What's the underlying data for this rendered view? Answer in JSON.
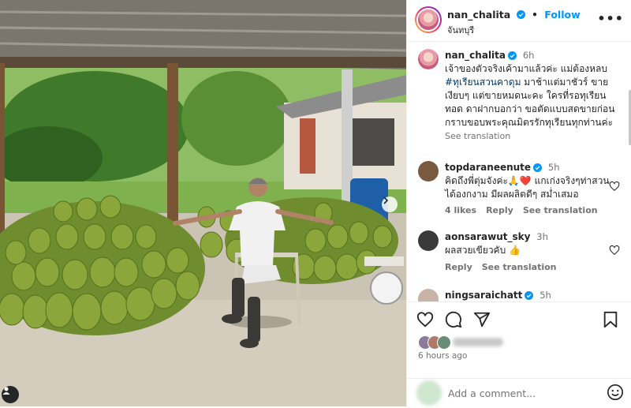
{
  "post": {
    "author": "nan_chalita",
    "location": "จันทบุรี",
    "follow_label": "Follow",
    "separator": "•",
    "more_label": "•••",
    "time_ago": "6 hours ago",
    "add_comment_placeholder": "Add a comment..."
  },
  "caption": {
    "username": "nan_chalita",
    "time": "6h",
    "text_before": "เจ้าของตัวจริงเค้ามาแล้วค่ะ แม่ต้องหลบ ",
    "hashtag": "#ทุเรียนสวนคาดุม",
    "text_after": " มาช้าแต่มาชัวร์ ขายเงียบๆ แต่ขายหมดนะคะ ใครที่รอทุเรียนทอด ดาฝากบอกว่า ขอตัดแบบสดขายก่อน กราบขอบพระคุณมิตรรักทุเรียนทุกท่านค่ะ",
    "see_translation": "See translation"
  },
  "comments": [
    {
      "username": "topdaraneenute",
      "time": "5h",
      "text": "คิดถึงพี่ตุ่มจังค่ะ🙏❤️ แกเก่งจริงๆท่าสวนได้องกงาม มีผลผลิตดีๆ สม่ำเสมอ",
      "likes": "4 likes",
      "reply": "Reply",
      "see_translation": "See translation"
    },
    {
      "username": "aonsarawut_sky",
      "time": "3h",
      "text": "ผลสวยเขียวคับ 👍",
      "reply": "Reply",
      "see_translation": "See translation"
    },
    {
      "username": "ningsaraichatt",
      "time": "5h"
    }
  ],
  "icons": {
    "like": "heart-icon",
    "comment": "comment-icon",
    "share": "share-icon",
    "save": "bookmark-icon",
    "emoji": "emoji-icon",
    "verified": "verified-badge-icon",
    "user_tag": "user-tag-icon",
    "next": "chevron-right-icon"
  },
  "colors": {
    "link": "#0095f6",
    "hashtag": "#00376b",
    "verified": "#0095f6",
    "muted": "#737373",
    "heart_red": "#ed4956"
  }
}
